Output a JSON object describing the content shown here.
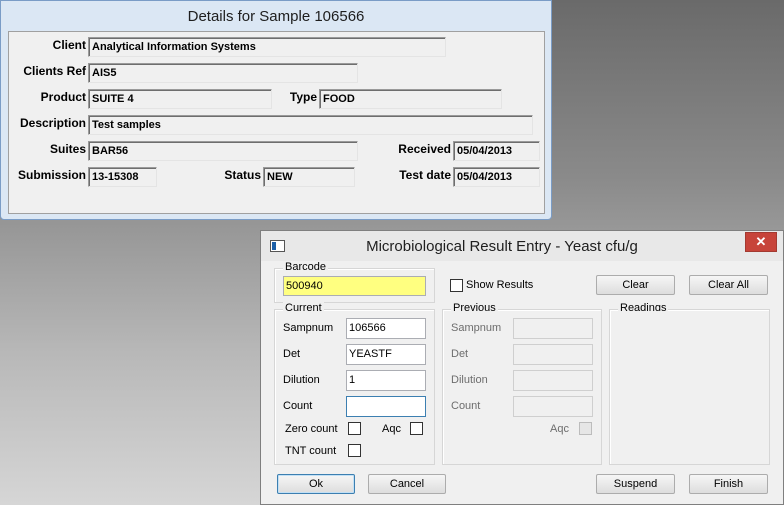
{
  "details": {
    "title": "Details for Sample 106566",
    "labels": {
      "client": "Client",
      "clients_ref": "Clients Ref",
      "product": "Product",
      "type": "Type",
      "description": "Description",
      "suites": "Suites",
      "received": "Received",
      "submission": "Submission",
      "status": "Status",
      "test_date": "Test date"
    },
    "values": {
      "client": "Analytical Information Systems",
      "clients_ref": "AIS5",
      "product": "SUITE 4",
      "type": "FOOD",
      "description": "Test samples",
      "suites": "BAR56",
      "received": "05/04/2013",
      "submission": "13-15308",
      "status": "NEW",
      "test_date": "05/04/2013"
    }
  },
  "micro": {
    "title": "Microbiological Result Entry - Yeast cfu/g",
    "close_glyph": "✕",
    "barcode": {
      "group_label": "Barcode",
      "value": "500940"
    },
    "show_results_label": "Show Results",
    "buttons": {
      "clear": "Clear",
      "clear_all": "Clear All",
      "ok": "Ok",
      "cancel": "Cancel",
      "suspend": "Suspend",
      "finish": "Finish"
    },
    "current": {
      "group_label": "Current",
      "sampnum_label": "Sampnum",
      "sampnum_value": "106566",
      "det_label": "Det",
      "det_value": "YEASTF",
      "dilution_label": "Dilution",
      "dilution_value": "1",
      "count_label": "Count",
      "count_value": "",
      "zero_count_label": "Zero count",
      "aqc_label": "Aqc",
      "tnt_count_label": "TNT count"
    },
    "previous": {
      "group_label": "Previous",
      "sampnum_label": "Sampnum",
      "det_label": "Det",
      "dilution_label": "Dilution",
      "count_label": "Count",
      "aqc_label": "Aqc"
    },
    "readings": {
      "group_label": "Readings"
    }
  }
}
